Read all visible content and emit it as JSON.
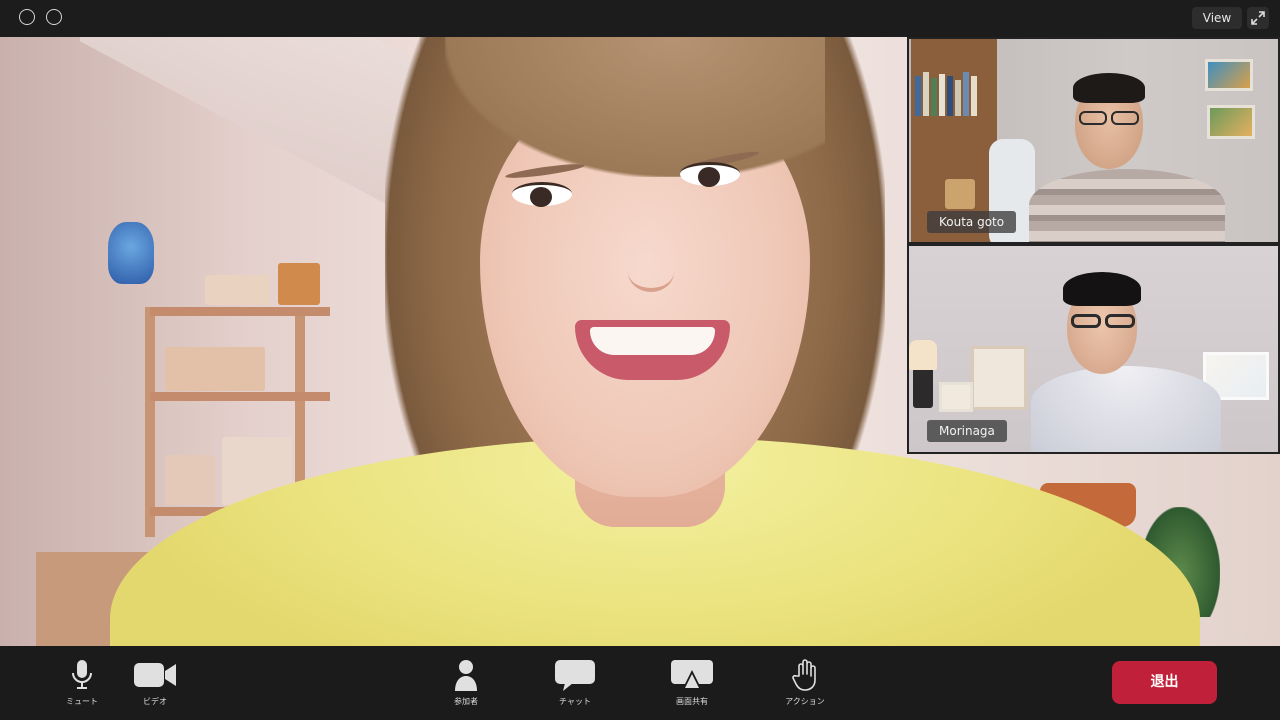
{
  "window": {
    "controls": [
      "circle-button",
      "circle-button"
    ]
  },
  "header": {
    "view_label": "View",
    "fullscreen_icon": "expand-arrows-icon"
  },
  "participants": [
    {
      "name": "Kouta goto"
    },
    {
      "name": "Morinaga"
    }
  ],
  "toolbar": {
    "mute_label": "ミュート",
    "video_label": "ビデオ",
    "participants_label": "参加者",
    "chat_label": "チャット",
    "share_label": "画面共有",
    "action_label": "アクション",
    "leave_label": "退出",
    "icons": {
      "mute": "microphone-icon",
      "video": "video-camera-icon",
      "participants": "person-icon",
      "chat": "chat-bubble-icon",
      "share": "screen-share-icon",
      "action": "raise-hand-icon"
    }
  },
  "colors": {
    "leave_button": "#c0203a",
    "toolbar_bg": "#1b1b1b"
  }
}
